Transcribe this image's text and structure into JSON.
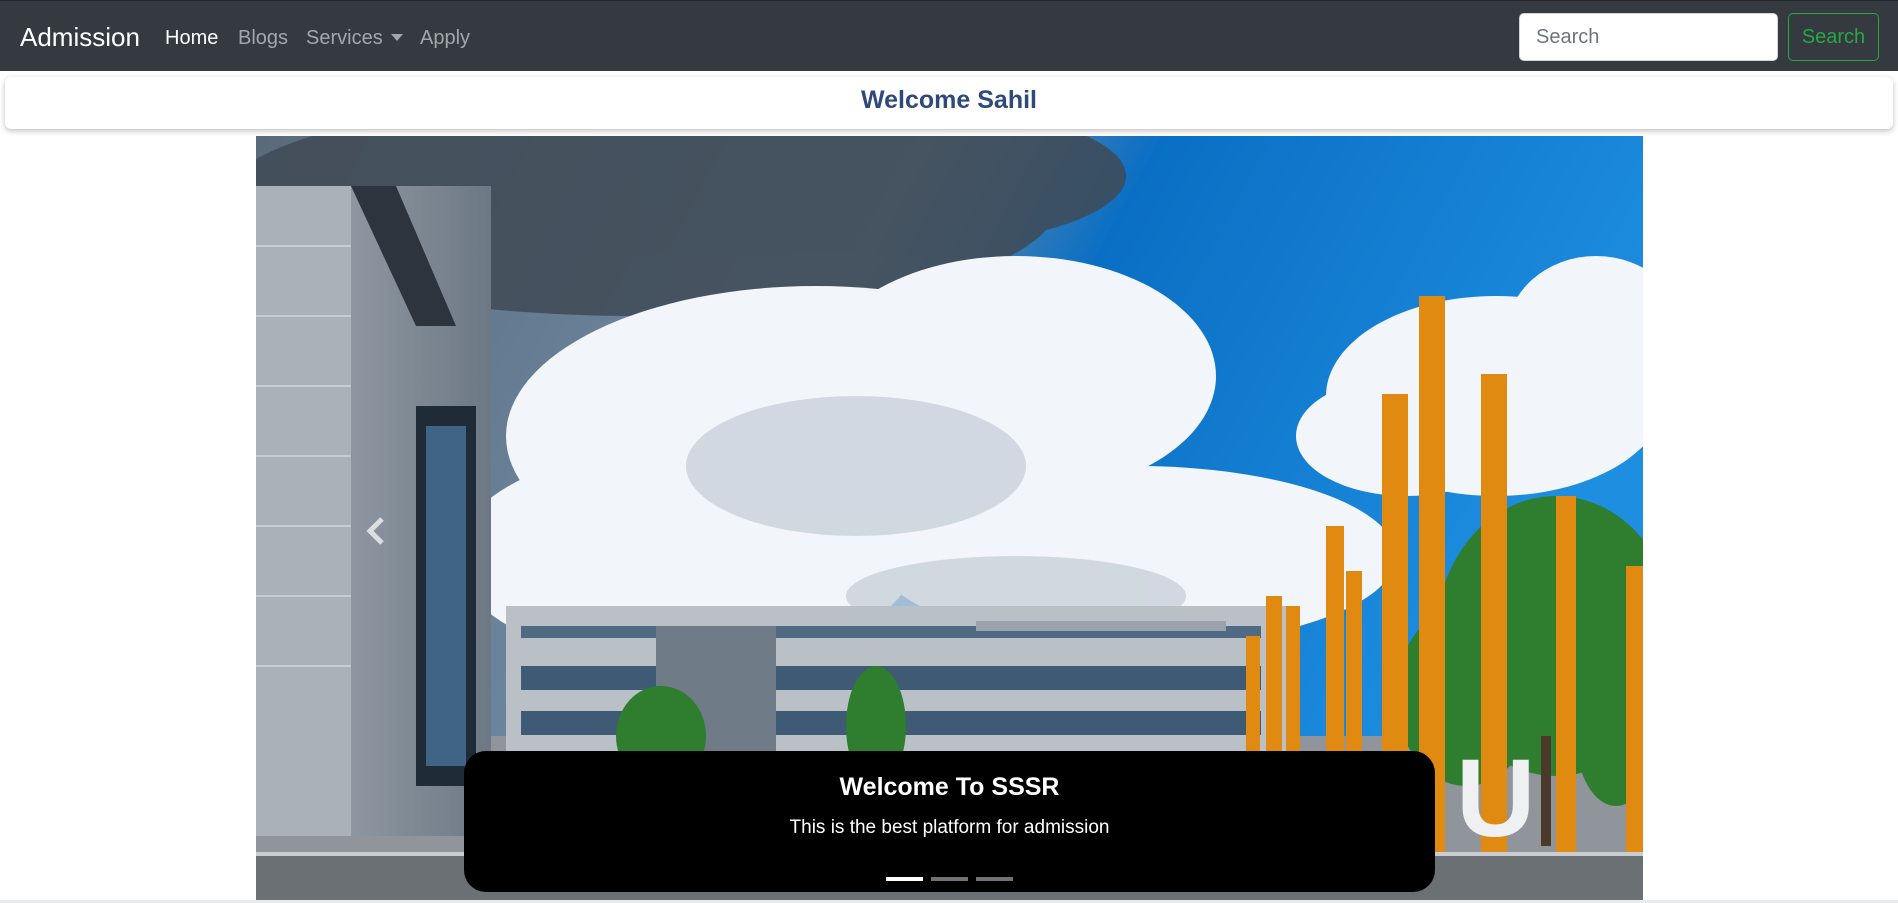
{
  "navbar": {
    "brand": "Admission",
    "links": [
      {
        "label": "Home",
        "active": true
      },
      {
        "label": "Blogs",
        "active": false
      },
      {
        "label": "Services",
        "active": false,
        "dropdown": true
      },
      {
        "label": "Apply",
        "active": false
      }
    ],
    "search_placeholder": "Search",
    "search_button": "Search"
  },
  "welcome": {
    "text": "Welcome Sahil"
  },
  "carousel": {
    "caption_title": "Welcome To SSSR",
    "caption_text": "This is the best platform for admission",
    "slide_count": 3,
    "active_slide": 1,
    "sign_letter": "U"
  },
  "colors": {
    "navbar_bg": "#343a40",
    "welcome_text": "#2f4a7a",
    "search_button": "#28a745",
    "caption_bg": "#000000"
  }
}
